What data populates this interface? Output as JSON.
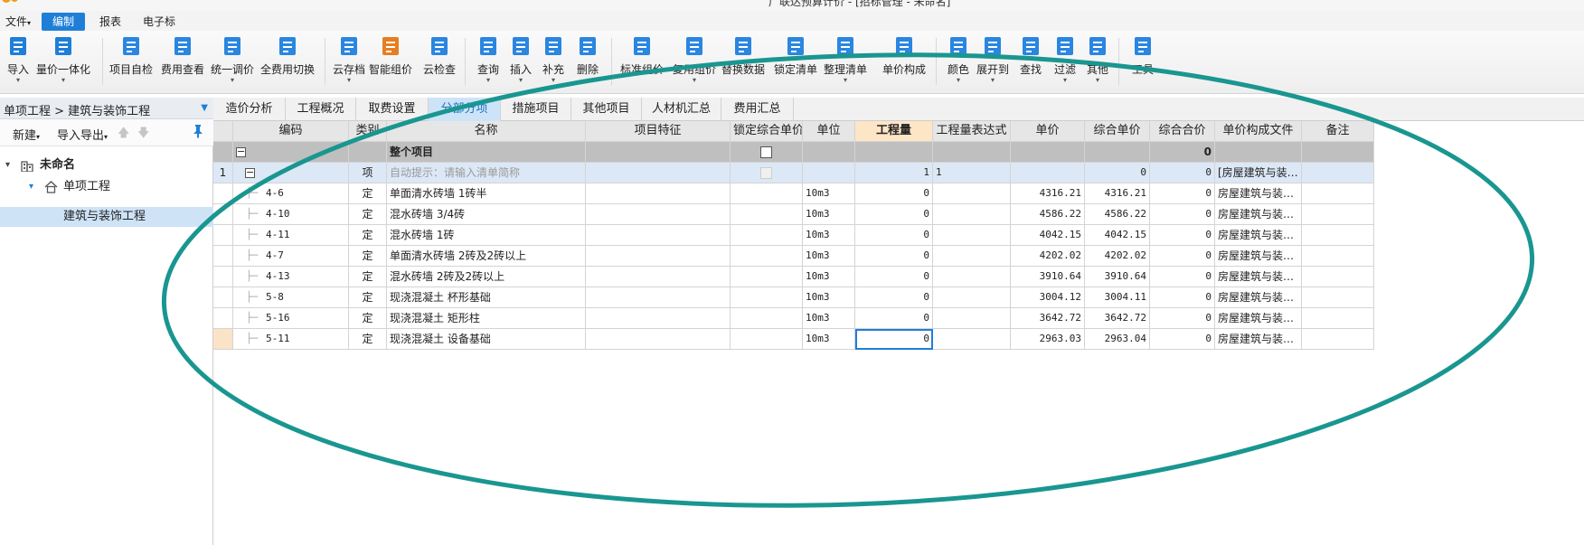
{
  "window": {
    "title": "广联达预算计价 - [招标管理 - 未命名]"
  },
  "menu": [
    {
      "label": "文件",
      "dropdown": "▾",
      "active": false
    },
    {
      "label": "编制",
      "active": true
    },
    {
      "label": "报表",
      "active": false
    },
    {
      "label": "电子标",
      "active": false
    }
  ],
  "ribbon": [
    {
      "label": "导入",
      "icon": "import-icon",
      "dd": "▾"
    },
    {
      "label": "量价一体化",
      "icon": "quantity-price-icon",
      "dd": "▾"
    },
    {
      "label": "项目自检",
      "icon": "self-check-icon",
      "dd": ""
    },
    {
      "label": "费用查看",
      "icon": "fee-view-icon",
      "dd": ""
    },
    {
      "label": "统一调价",
      "icon": "unified-price-icon",
      "dd": "▾"
    },
    {
      "label": "全费用切换",
      "icon": "full-fee-switch-icon",
      "dd": ""
    },
    {
      "label": "云存档",
      "icon": "cloud-archive-icon",
      "dd": "▾"
    },
    {
      "label": "智能组价",
      "icon": "smart-pricing-icon",
      "dd": ""
    },
    {
      "label": "云检查",
      "icon": "cloud-check-icon",
      "dd": ""
    },
    {
      "label": "查询",
      "icon": "query-icon",
      "dd": "▾"
    },
    {
      "label": "插入",
      "icon": "insert-icon",
      "dd": "▾"
    },
    {
      "label": "补充",
      "icon": "supplement-icon",
      "dd": "▾"
    },
    {
      "label": "删除",
      "icon": "delete-icon",
      "dd": ""
    },
    {
      "label": "标准组价",
      "icon": "standard-pricing-icon",
      "dd": ""
    },
    {
      "label": "复用组价",
      "icon": "reuse-pricing-icon",
      "dd": "▾"
    },
    {
      "label": "替换数据",
      "icon": "replace-data-icon",
      "dd": ""
    },
    {
      "label": "锁定清单",
      "icon": "lock-list-icon",
      "dd": ""
    },
    {
      "label": "整理清单",
      "icon": "organize-list-icon",
      "dd": "▾"
    },
    {
      "label": "单价构成",
      "icon": "unit-price-icon",
      "dd": ""
    },
    {
      "label": "颜色",
      "icon": "color-icon",
      "dd": "▾"
    },
    {
      "label": "展开到",
      "icon": "expand-to-icon",
      "dd": "▾"
    },
    {
      "label": "查找",
      "icon": "find-icon",
      "dd": ""
    },
    {
      "label": "过滤",
      "icon": "filter-icon",
      "dd": "▾"
    },
    {
      "label": "其他",
      "icon": "other-icon",
      "dd": "▾"
    },
    {
      "label": "工具",
      "icon": "tools-icon",
      "dd": ""
    }
  ],
  "left": {
    "breadcrumb": "单项工程 > 建筑与装饰工程",
    "new_label": "新建",
    "import_export_label": "导入导出",
    "dd": "▾",
    "up_arrow": "🡅",
    "down_arrow": "🡇",
    "pin": "📌",
    "tree": {
      "root": {
        "label": "未命名",
        "toggle": "▾"
      },
      "level1": {
        "label": "单项工程",
        "toggle": "▾"
      },
      "level2": {
        "label": "建筑与装饰工程"
      }
    }
  },
  "tabs": [
    "造价分析",
    "工程概况",
    "取费设置",
    "分部分项",
    "措施项目",
    "其他项目",
    "人材机汇总",
    "费用汇总"
  ],
  "active_tab": 3,
  "grid": {
    "columns": [
      "",
      "编码",
      "类别",
      "名称",
      "项目特征",
      "锁定综合单价",
      "单位",
      "工程量",
      "工程量表达式",
      "单价",
      "综合单价",
      "综合合价",
      "单价构成文件",
      "备注"
    ],
    "summary_row": {
      "name": "整个项目",
      "total": "0",
      "minus": "−"
    },
    "item_row": {
      "index": "1",
      "type": "项",
      "name": "自动提示：请输入清单简称",
      "qty": "1",
      "expr": "1",
      "total_price": "0",
      "combined_total": "0",
      "file": "[房屋建筑与装…",
      "minus": "−"
    },
    "rows": [
      {
        "code": "4-6",
        "type": "定",
        "name": "单面清水砖墙 1砖半",
        "unit": "10m3",
        "qty": "0",
        "price": "4316.21",
        "cprice": "4316.21",
        "ctotal": "0",
        "file": "房屋建筑与装…"
      },
      {
        "code": "4-10",
        "type": "定",
        "name": "混水砖墙 3/4砖",
        "unit": "10m3",
        "qty": "0",
        "price": "4586.22",
        "cprice": "4586.22",
        "ctotal": "0",
        "file": "房屋建筑与装…"
      },
      {
        "code": "4-11",
        "type": "定",
        "name": "混水砖墙 1砖",
        "unit": "10m3",
        "qty": "0",
        "price": "4042.15",
        "cprice": "4042.15",
        "ctotal": "0",
        "file": "房屋建筑与装…"
      },
      {
        "code": "4-7",
        "type": "定",
        "name": "单面清水砖墙 2砖及2砖以上",
        "unit": "10m3",
        "qty": "0",
        "price": "4202.02",
        "cprice": "4202.02",
        "ctotal": "0",
        "file": "房屋建筑与装…"
      },
      {
        "code": "4-13",
        "type": "定",
        "name": "混水砖墙 2砖及2砖以上",
        "unit": "10m3",
        "qty": "0",
        "price": "3910.64",
        "cprice": "3910.64",
        "ctotal": "0",
        "file": "房屋建筑与装…"
      },
      {
        "code": "5-8",
        "type": "定",
        "name": "现浇混凝土 杯形基础",
        "unit": "10m3",
        "qty": "0",
        "price": "3004.12",
        "cprice": "3004.11",
        "ctotal": "0",
        "file": "房屋建筑与装…"
      },
      {
        "code": "5-16",
        "type": "定",
        "name": "现浇混凝土 矩形柱",
        "unit": "10m3",
        "qty": "0",
        "price": "3642.72",
        "cprice": "3642.72",
        "ctotal": "0",
        "file": "房屋建筑与装…"
      },
      {
        "code": "5-11",
        "type": "定",
        "name": "现浇混凝土 设备基础",
        "unit": "10m3",
        "qty": "0",
        "price": "2963.03",
        "cprice": "2963.04",
        "ctotal": "0",
        "file": "房屋建筑与装…"
      }
    ]
  },
  "colors": {
    "accent": "#1f7fd8",
    "annotation": "#1a9690",
    "summary_row": "#bfbfbf",
    "selected_row": "#dce8f6",
    "qty_header": "#fde6c6"
  }
}
